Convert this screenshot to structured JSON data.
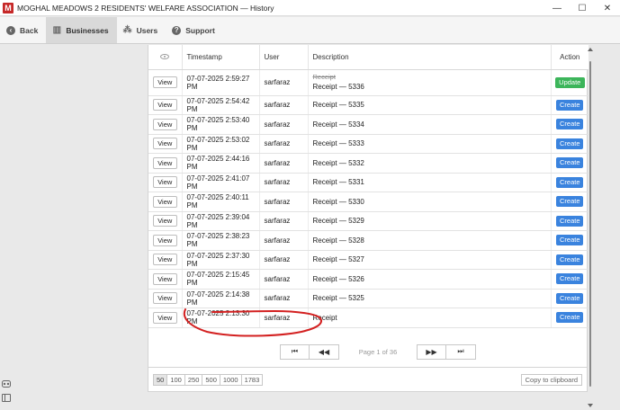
{
  "window": {
    "app_icon_letter": "M",
    "title": "MOGHAL MEADOWS 2 RESIDENTS' WELFARE ASSOCIATION — History",
    "minimize": "—",
    "maximize": "☐",
    "close": "✕"
  },
  "toolbar": {
    "back": "Back",
    "businesses": "Businesses",
    "users": "Users",
    "support": "Support"
  },
  "table": {
    "columns": [
      "",
      "Timestamp",
      "User",
      "Description",
      "Action"
    ],
    "rows": [
      {
        "view": "View",
        "timestamp": "07-07-2025 2:59:27 PM",
        "user": "sarfaraz",
        "desc_old": "Receipt",
        "desc": "Receipt — 5336",
        "action": "Update",
        "action_color": "#3cb55a"
      },
      {
        "view": "View",
        "timestamp": "07-07-2025 2:54:42 PM",
        "user": "sarfaraz",
        "desc": "Receipt — 5335",
        "action": "Create",
        "action_color": "#3a83de"
      },
      {
        "view": "View",
        "timestamp": "07-07-2025 2:53:40 PM",
        "user": "sarfaraz",
        "desc": "Receipt — 5334",
        "action": "Create",
        "action_color": "#3a83de"
      },
      {
        "view": "View",
        "timestamp": "07-07-2025 2:53:02 PM",
        "user": "sarfaraz",
        "desc": "Receipt — 5333",
        "action": "Create",
        "action_color": "#3a83de"
      },
      {
        "view": "View",
        "timestamp": "07-07-2025 2:44:16 PM",
        "user": "sarfaraz",
        "desc": "Receipt — 5332",
        "action": "Create",
        "action_color": "#3a83de"
      },
      {
        "view": "View",
        "timestamp": "07-07-2025 2:41:07 PM",
        "user": "sarfaraz",
        "desc": "Receipt — 5331",
        "action": "Create",
        "action_color": "#3a83de"
      },
      {
        "view": "View",
        "timestamp": "07-07-2025 2:40:11 PM",
        "user": "sarfaraz",
        "desc": "Receipt — 5330",
        "action": "Create",
        "action_color": "#3a83de"
      },
      {
        "view": "View",
        "timestamp": "07-07-2025 2:39:04 PM",
        "user": "sarfaraz",
        "desc": "Receipt — 5329",
        "action": "Create",
        "action_color": "#3a83de"
      },
      {
        "view": "View",
        "timestamp": "07-07-2025 2:38:23 PM",
        "user": "sarfaraz",
        "desc": "Receipt — 5328",
        "action": "Create",
        "action_color": "#3a83de"
      },
      {
        "view": "View",
        "timestamp": "07-07-2025 2:37:30 PM",
        "user": "sarfaraz",
        "desc": "Receipt — 5327",
        "action": "Create",
        "action_color": "#3a83de"
      },
      {
        "view": "View",
        "timestamp": "07-07-2025 2:15:45 PM",
        "user": "sarfaraz",
        "desc": "Receipt — 5326",
        "action": "Create",
        "action_color": "#3a83de"
      },
      {
        "view": "View",
        "timestamp": "07-07-2025 2:14:38 PM",
        "user": "sarfaraz",
        "desc": "Receipt — 5325",
        "action": "Create",
        "action_color": "#3a83de"
      },
      {
        "view": "View",
        "timestamp": "07-07-2025 2:13:30 PM",
        "user": "sarfaraz",
        "desc": "Receipt",
        "action": "Create",
        "action_color": "#3a83de"
      }
    ]
  },
  "pager": {
    "first": "⏮",
    "prev": "◀◀",
    "info": "Page 1 of 36",
    "next": "▶▶",
    "last": "⏭"
  },
  "page_sizes": [
    "50",
    "100",
    "250",
    "500",
    "1000",
    "1783"
  ],
  "selected_page_size": "50",
  "copy_label": "Copy to clipboard",
  "annotation_color": "#d32020"
}
